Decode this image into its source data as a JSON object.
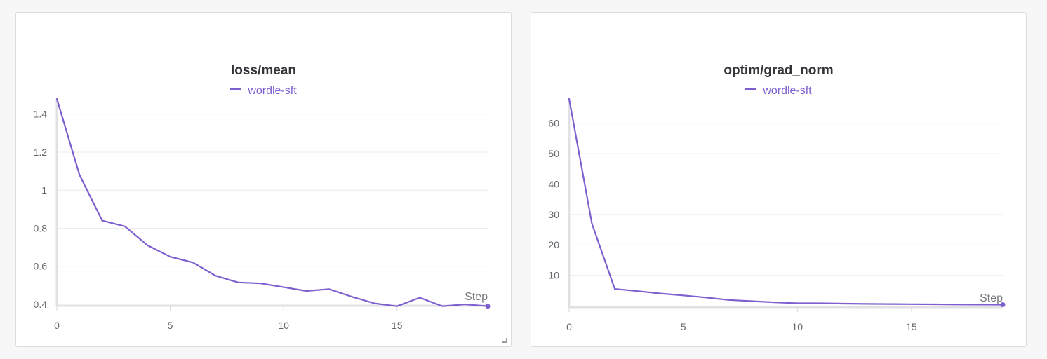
{
  "chart_data": [
    {
      "type": "line",
      "title": "loss/mean",
      "xlabel": "Step",
      "ylabel": "",
      "xlim": [
        0,
        19
      ],
      "ylim": [
        0.4,
        1.48
      ],
      "x_ticks": [
        0,
        5,
        10,
        15
      ],
      "x_tick_labels": [
        "0",
        "5",
        "10",
        "15"
      ],
      "y_ticks": [
        0.4,
        0.6,
        0.8,
        1,
        1.2,
        1.4
      ],
      "y_tick_labels": [
        "0.4",
        "0.6",
        "0.8",
        "1",
        "1.2",
        "1.4"
      ],
      "grid": true,
      "legend_position": "top-center",
      "series": [
        {
          "name": "wordle-sft",
          "color": "#7e5fcf",
          "x": [
            0,
            1,
            2,
            3,
            4,
            5,
            6,
            7,
            8,
            9,
            10,
            11,
            12,
            13,
            14,
            15,
            16,
            17,
            18,
            19
          ],
          "values": [
            1.48,
            1.08,
            0.84,
            0.81,
            0.71,
            0.65,
            0.62,
            0.55,
            0.515,
            0.51,
            0.49,
            0.47,
            0.48,
            0.44,
            0.405,
            0.39,
            0.435,
            0.39,
            0.4,
            0.39
          ]
        }
      ]
    },
    {
      "type": "line",
      "title": "optim/grad_norm",
      "xlabel": "Step",
      "ylabel": "",
      "xlim": [
        0,
        19
      ],
      "ylim": [
        0,
        68
      ],
      "x_ticks": [
        0,
        5,
        10,
        15
      ],
      "x_tick_labels": [
        "0",
        "5",
        "10",
        "15"
      ],
      "y_ticks": [
        10,
        20,
        30,
        40,
        50,
        60
      ],
      "y_tick_labels": [
        "10",
        "20",
        "30",
        "40",
        "50",
        "60"
      ],
      "grid": true,
      "legend_position": "top-center",
      "series": [
        {
          "name": "wordle-sft",
          "color": "#7e5fcf",
          "x": [
            0,
            1,
            2,
            3,
            4,
            5,
            6,
            7,
            8,
            9,
            10,
            11,
            12,
            13,
            14,
            15,
            16,
            17,
            18,
            19
          ],
          "values": [
            68,
            27,
            5.5,
            4.8,
            4,
            3.4,
            2.7,
            1.9,
            1.5,
            1.1,
            0.8,
            0.8,
            0.7,
            0.6,
            0.55,
            0.5,
            0.45,
            0.4,
            0.38,
            0.35
          ]
        }
      ]
    }
  ]
}
